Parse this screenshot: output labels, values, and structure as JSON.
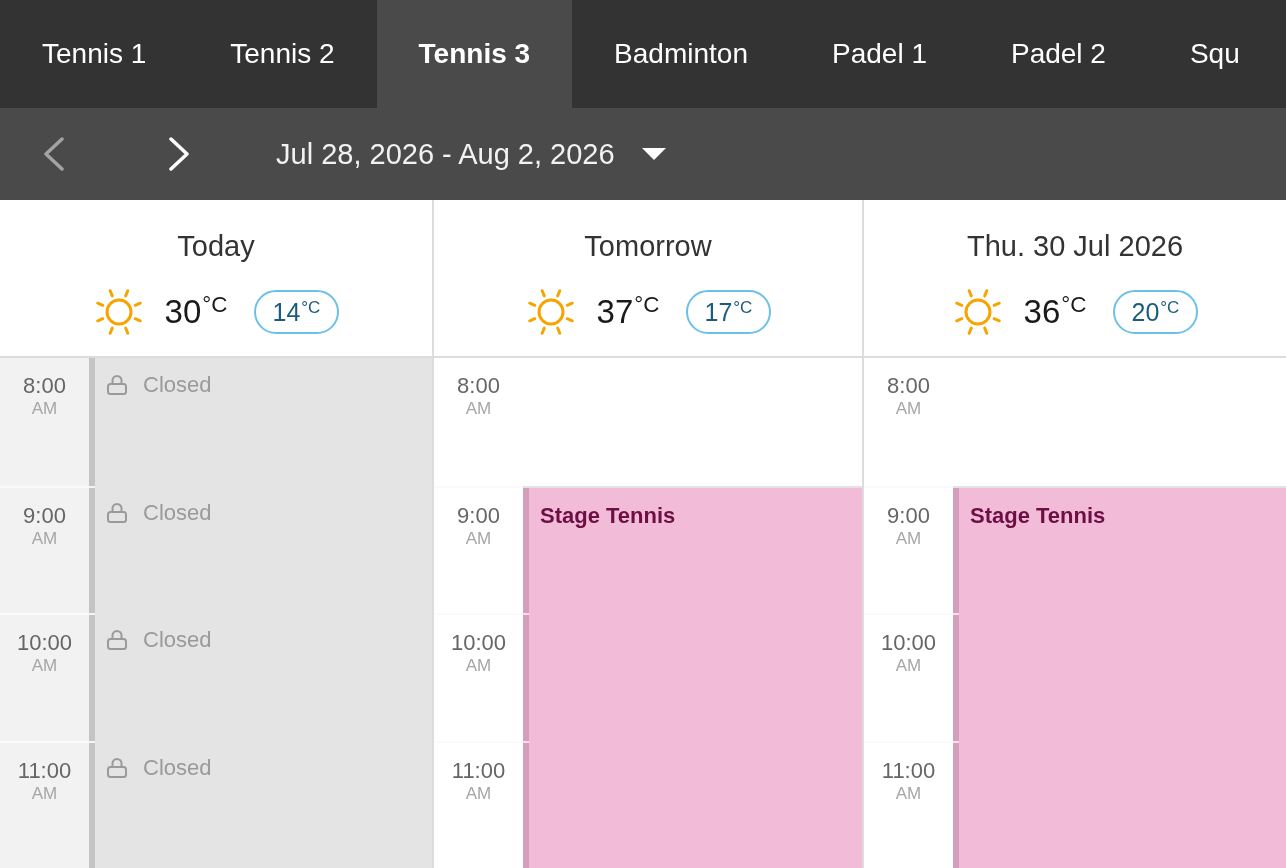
{
  "tabs": [
    {
      "label": "Tennis 1",
      "selected": false
    },
    {
      "label": "Tennis 2",
      "selected": false
    },
    {
      "label": "Tennis 3",
      "selected": true
    },
    {
      "label": "Badminton",
      "selected": false
    },
    {
      "label": "Padel 1",
      "selected": false
    },
    {
      "label": "Padel 2",
      "selected": false
    },
    {
      "label": "Squ",
      "selected": false
    }
  ],
  "toolbar": {
    "previous": {
      "disabled": true
    },
    "next": {
      "disabled": false
    },
    "date_range": "Jul 28, 2026 - Aug 2, 2026"
  },
  "days": [
    {
      "title": "Today",
      "weather": {
        "high": "30$^{°C}$",
        "low": "14$^{°C}$"
      },
      "slots": [
        {
          "time": "8:00",
          "period": "AM",
          "kind": "closed",
          "label": "Closed"
        },
        {
          "time": "9:00",
          "period": "AM",
          "kind": "closed",
          "label": "Closed"
        },
        {
          "time": "10:00",
          "period": "AM",
          "kind": "closed",
          "label": "Closed"
        },
        {
          "time": "11:00",
          "period": "AM",
          "kind": "closed",
          "label": "Closed"
        }
      ]
    },
    {
      "title": "Tomorrow",
      "weather": {
        "high": "37$^{°C}$",
        "low": "17$^{°C}$"
      },
      "slots": [
        {
          "time": "8:00",
          "period": "AM",
          "kind": "free"
        },
        {
          "time": "9:00",
          "period": "AM",
          "kind": "event",
          "title": "Stage Tennis"
        },
        {
          "time": "10:00",
          "period": "AM",
          "kind": "event"
        },
        {
          "time": "11:00",
          "period": "AM",
          "kind": "event"
        }
      ]
    },
    {
      "title": "Thu. 30 Jul 2026",
      "weather": {
        "high": "36$^{°C}$",
        "low": "20$^{°C}$"
      },
      "slots": [
        {
          "time": "8:00",
          "period": "AM",
          "kind": "free"
        },
        {
          "time": "9:00",
          "period": "AM",
          "kind": "event",
          "title": "Stage Tennis"
        },
        {
          "time": "10:00",
          "period": "AM",
          "kind": "event"
        },
        {
          "time": "11:00",
          "period": "AM",
          "kind": "event"
        }
      ]
    }
  ]
}
